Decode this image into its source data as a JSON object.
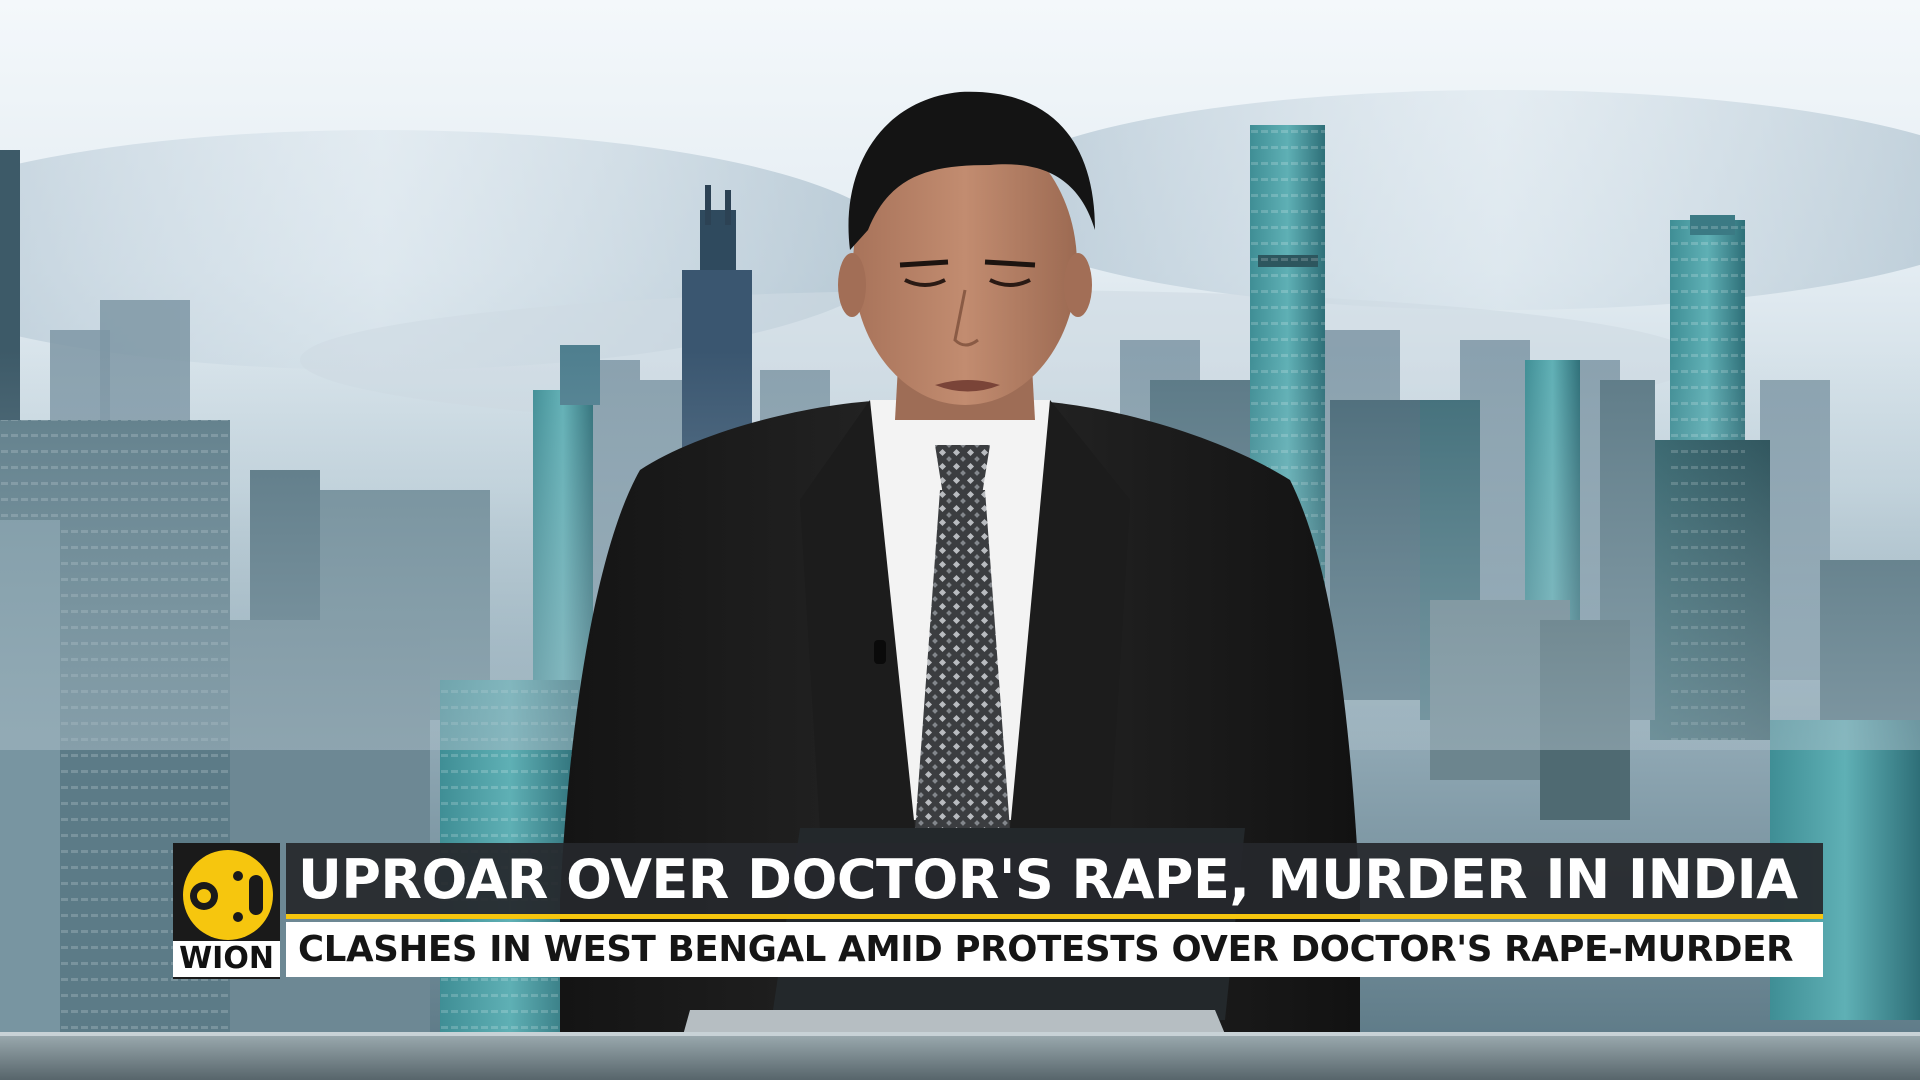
{
  "broadcast": {
    "channel_logo_text": "WION",
    "headline": "UPROAR OVER DOCTOR'S RAPE, MURDER IN INDIA",
    "subheadline": "CLASHES IN WEST BENGAL AMID PROTESTS OVER DOCTOR'S RAPE-MURDER"
  },
  "colors": {
    "accent_yellow": "#f6c60e",
    "headline_bar": "#26282c",
    "subline_bar": "#ffffff"
  },
  "icons": {
    "logo": "wion-logo-icon"
  }
}
